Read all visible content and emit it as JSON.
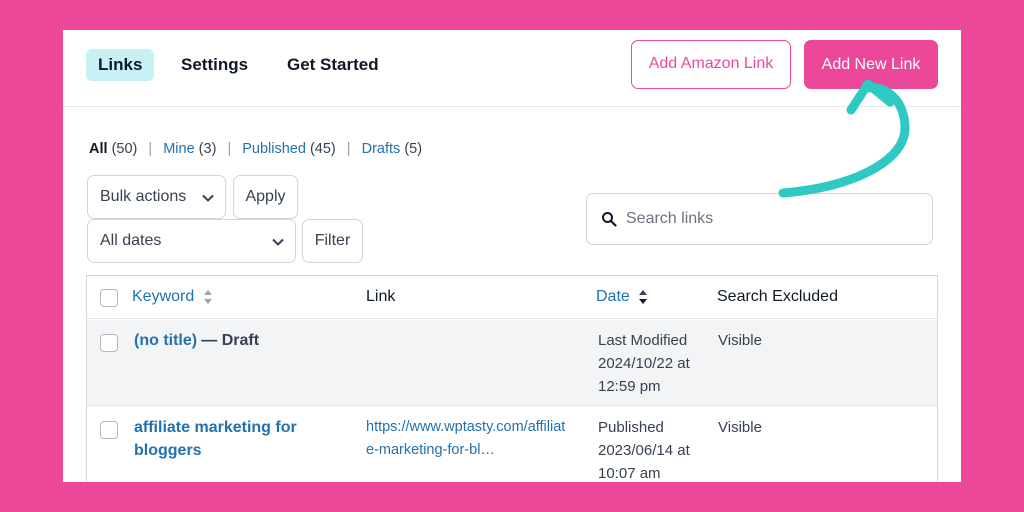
{
  "nav": {
    "tabs": [
      {
        "label": "Links",
        "active": true
      },
      {
        "label": "Settings",
        "active": false
      },
      {
        "label": "Get Started",
        "active": false
      }
    ],
    "add_amazon_label": "Add Amazon Link",
    "add_new_label": "Add New Link"
  },
  "filters": {
    "all_label": "All",
    "all_count": "(50)",
    "mine_label": "Mine",
    "mine_count": "(3)",
    "published_label": "Published",
    "published_count": "(45)",
    "drafts_label": "Drafts",
    "drafts_count": "(5)",
    "separator": "|"
  },
  "controls": {
    "bulk_actions": "Bulk actions",
    "apply": "Apply",
    "all_dates": "All dates",
    "filter": "Filter"
  },
  "search": {
    "placeholder": "Search links"
  },
  "table": {
    "headers": {
      "keyword": "Keyword",
      "link": "Link",
      "date": "Date",
      "search_excluded": "Search Excluded"
    },
    "rows": [
      {
        "keyword": "(no title)",
        "suffix": "— Draft",
        "link_line1": "",
        "link_line2": "",
        "date_line1": "Last Modified",
        "date_line2": "2024/10/22 at",
        "date_line3": "12:59 pm",
        "excluded": "Visible"
      },
      {
        "keyword_line1": "affiliate marketing for",
        "keyword_line2": "bloggers",
        "link_line1": "https://www.wptasty.com/affiliat",
        "link_line2": "e-marketing-for-bl…",
        "date_line1": "Published",
        "date_line2": "2023/06/14 at",
        "date_line3": "10:07 am",
        "excluded": "Visible"
      }
    ]
  },
  "colors": {
    "brand_pink": "#ec4899",
    "link_blue": "#2271b1",
    "arrow_teal": "#2ec9c3"
  }
}
